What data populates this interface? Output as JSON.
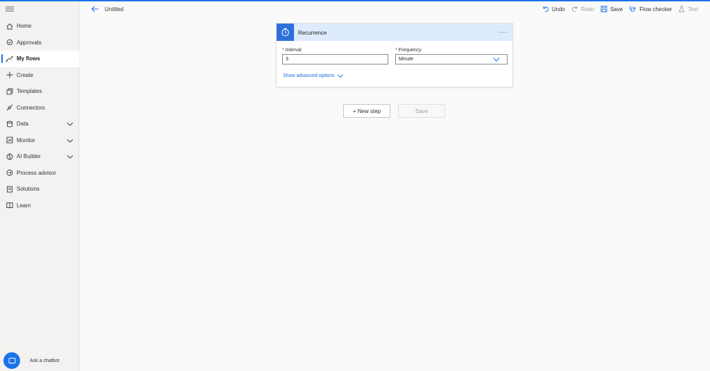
{
  "sidebar": {
    "items": [
      {
        "label": "Home",
        "icon": "home-icon"
      },
      {
        "label": "Approvals",
        "icon": "approvals-icon"
      },
      {
        "label": "My flows",
        "icon": "flows-icon",
        "active": true
      },
      {
        "label": "Create",
        "icon": "plus-icon"
      },
      {
        "label": "Templates",
        "icon": "templates-icon"
      },
      {
        "label": "Connectors",
        "icon": "connectors-icon"
      },
      {
        "label": "Data",
        "icon": "data-icon",
        "expandable": true
      },
      {
        "label": "Monitor",
        "icon": "monitor-icon",
        "expandable": true
      },
      {
        "label": "AI Builder",
        "icon": "ai-builder-icon",
        "expandable": true
      },
      {
        "label": "Process advisor",
        "icon": "process-advisor-icon"
      },
      {
        "label": "Solutions",
        "icon": "solutions-icon"
      },
      {
        "label": "Learn",
        "icon": "learn-icon"
      }
    ],
    "chatbot_label": "Ask a chatbot"
  },
  "header": {
    "title": "Untitled",
    "actions": {
      "undo": "Undo",
      "redo": "Redo",
      "save": "Save",
      "flow_checker": "Flow checker",
      "test": "Test"
    }
  },
  "card": {
    "title": "Recurrence",
    "interval_label": "Interval",
    "interval_value": "3",
    "frequency_label": "Frequency",
    "frequency_value": "Minute",
    "required_mark": "*",
    "advanced": "Show advanced options"
  },
  "buttons": {
    "new_step": "+ New step",
    "save": "Save"
  },
  "colors": {
    "accent": "#1a73e8",
    "card_header": "#deebfc",
    "trigger_icon_bg": "#2f6fdb",
    "required": "#a4262c"
  }
}
